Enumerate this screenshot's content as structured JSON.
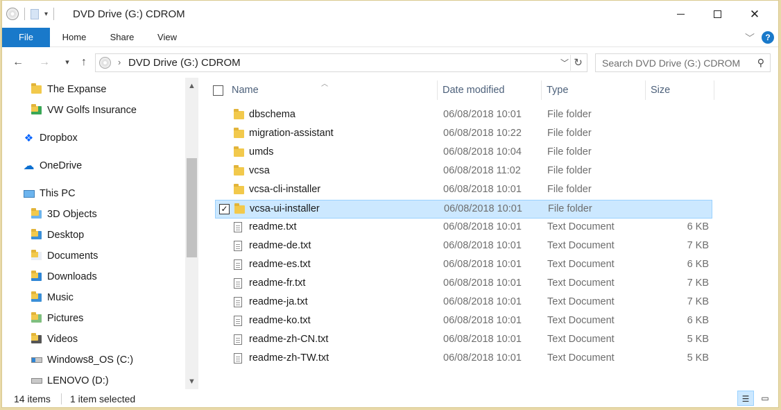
{
  "window": {
    "title": "DVD Drive (G:) CDROM"
  },
  "ribbon": {
    "tabs": [
      {
        "label": "File"
      },
      {
        "label": "Home"
      },
      {
        "label": "Share"
      },
      {
        "label": "View"
      }
    ]
  },
  "address": {
    "path": "DVD Drive (G:) CDROM"
  },
  "search": {
    "placeholder": "Search DVD Drive (G:) CDROM"
  },
  "sidebar": {
    "items": [
      {
        "label": "The Expanse",
        "icon": "folder-icon"
      },
      {
        "label": "VW Golfs Insurance",
        "icon": "folder-synced-icon"
      },
      {
        "label": "Dropbox",
        "icon": "dropbox-icon"
      },
      {
        "label": "OneDrive",
        "icon": "onedrive-cloud-icon"
      },
      {
        "label": "This PC",
        "icon": "computer-icon"
      },
      {
        "label": "3D Objects",
        "icon": "3d-objects-icon"
      },
      {
        "label": "Desktop",
        "icon": "desktop-folder-icon"
      },
      {
        "label": "Documents",
        "icon": "documents-folder-icon"
      },
      {
        "label": "Downloads",
        "icon": "downloads-folder-icon"
      },
      {
        "label": "Music",
        "icon": "music-folder-icon"
      },
      {
        "label": "Pictures",
        "icon": "pictures-folder-icon"
      },
      {
        "label": "Videos",
        "icon": "videos-folder-icon"
      },
      {
        "label": "Windows8_OS (C:)",
        "icon": "windows-drive-icon"
      },
      {
        "label": "LENOVO (D:)",
        "icon": "drive-icon"
      }
    ]
  },
  "columns": {
    "name": "Name",
    "date": "Date modified",
    "type": "Type",
    "size": "Size"
  },
  "files": [
    {
      "name": "dbschema",
      "date": "06/08/2018 10:01",
      "type": "File folder",
      "size": "",
      "kind": "folder"
    },
    {
      "name": "migration-assistant",
      "date": "06/08/2018 10:22",
      "type": "File folder",
      "size": "",
      "kind": "folder"
    },
    {
      "name": "umds",
      "date": "06/08/2018 10:04",
      "type": "File folder",
      "size": "",
      "kind": "folder"
    },
    {
      "name": "vcsa",
      "date": "06/08/2018 11:02",
      "type": "File folder",
      "size": "",
      "kind": "folder"
    },
    {
      "name": "vcsa-cli-installer",
      "date": "06/08/2018 10:01",
      "type": "File folder",
      "size": "",
      "kind": "folder"
    },
    {
      "name": "vcsa-ui-installer",
      "date": "06/08/2018 10:01",
      "type": "File folder",
      "size": "",
      "kind": "folder",
      "selected": true
    },
    {
      "name": "readme.txt",
      "date": "06/08/2018 10:01",
      "type": "Text Document",
      "size": "6 KB",
      "kind": "doc"
    },
    {
      "name": "readme-de.txt",
      "date": "06/08/2018 10:01",
      "type": "Text Document",
      "size": "7 KB",
      "kind": "doc"
    },
    {
      "name": "readme-es.txt",
      "date": "06/08/2018 10:01",
      "type": "Text Document",
      "size": "6 KB",
      "kind": "doc"
    },
    {
      "name": "readme-fr.txt",
      "date": "06/08/2018 10:01",
      "type": "Text Document",
      "size": "7 KB",
      "kind": "doc"
    },
    {
      "name": "readme-ja.txt",
      "date": "06/08/2018 10:01",
      "type": "Text Document",
      "size": "7 KB",
      "kind": "doc"
    },
    {
      "name": "readme-ko.txt",
      "date": "06/08/2018 10:01",
      "type": "Text Document",
      "size": "6 KB",
      "kind": "doc"
    },
    {
      "name": "readme-zh-CN.txt",
      "date": "06/08/2018 10:01",
      "type": "Text Document",
      "size": "5 KB",
      "kind": "doc"
    },
    {
      "name": "readme-zh-TW.txt",
      "date": "06/08/2018 10:01",
      "type": "Text Document",
      "size": "5 KB",
      "kind": "doc"
    }
  ],
  "status": {
    "item_count": "14 items",
    "selection": "1 item selected"
  },
  "colors": {
    "accent": "#1979ca",
    "selection": "#cce8ff",
    "folder": "#f2c94c"
  }
}
